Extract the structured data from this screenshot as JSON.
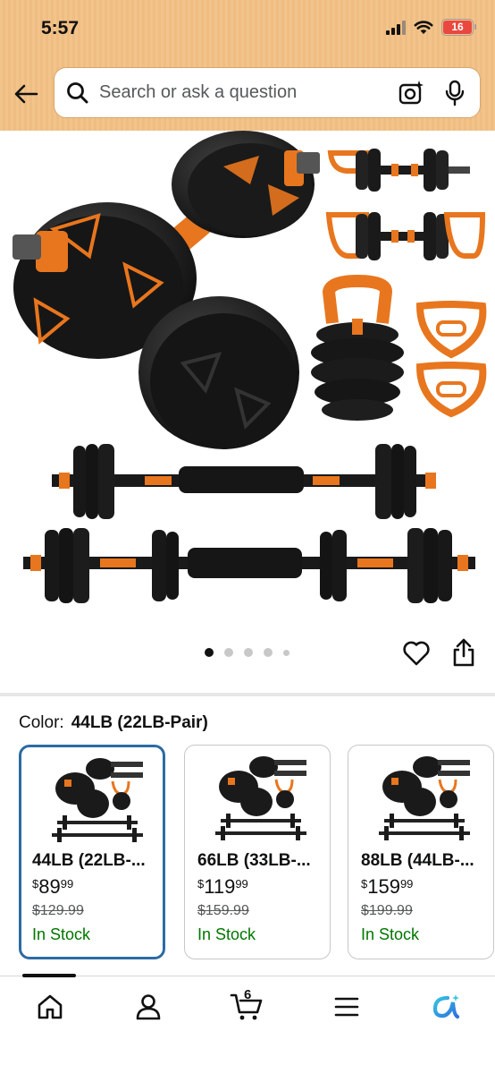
{
  "status_bar": {
    "time": "5:57",
    "battery": "16",
    "battery_color": "#e9483f"
  },
  "header": {
    "back_icon": "arrow-left-icon",
    "search": {
      "placeholder": "Search or ask a question",
      "search_icon": "magnifier-icon",
      "camera_icon": "camera-sparkle-icon",
      "mic_icon": "microphone-icon"
    },
    "background_color": "#f2c48b"
  },
  "gallery": {
    "image_alt": "Adjustable dumbbell set with barbell and kettlebell configurations",
    "dots": [
      {
        "active": true
      },
      {
        "active": false
      },
      {
        "active": false
      },
      {
        "active": false
      },
      {
        "active": false,
        "small": true
      }
    ],
    "heart_icon": "heart-outline-icon",
    "share_icon": "share-icon"
  },
  "color_selector": {
    "label": "Color:",
    "selected_value": "44LB (22LB-Pair)",
    "options": [
      {
        "title": "44LB (22LB-...",
        "currency": "$",
        "price_whole": "89",
        "price_cents": "99",
        "list_price": "$129.99",
        "stock": "In Stock",
        "selected": true
      },
      {
        "title": "66LB (33LB-...",
        "currency": "$",
        "price_whole": "119",
        "price_cents": "99",
        "list_price": "$159.99",
        "stock": "In Stock",
        "selected": false
      },
      {
        "title": "88LB (44LB-...",
        "currency": "$",
        "price_whole": "159",
        "price_cents": "99",
        "list_price": "$199.99",
        "stock": "In Stock",
        "selected": false
      }
    ],
    "selected_border_color": "#2d6ba4",
    "stock_color": "#007600"
  },
  "bottom_nav": {
    "items": [
      {
        "name": "home",
        "icon": "home-icon"
      },
      {
        "name": "account",
        "icon": "person-icon"
      },
      {
        "name": "cart",
        "icon": "cart-icon",
        "count": "6"
      },
      {
        "name": "menu",
        "icon": "menu-icon"
      },
      {
        "name": "rufus",
        "icon": "rufus-ai-icon"
      }
    ]
  }
}
